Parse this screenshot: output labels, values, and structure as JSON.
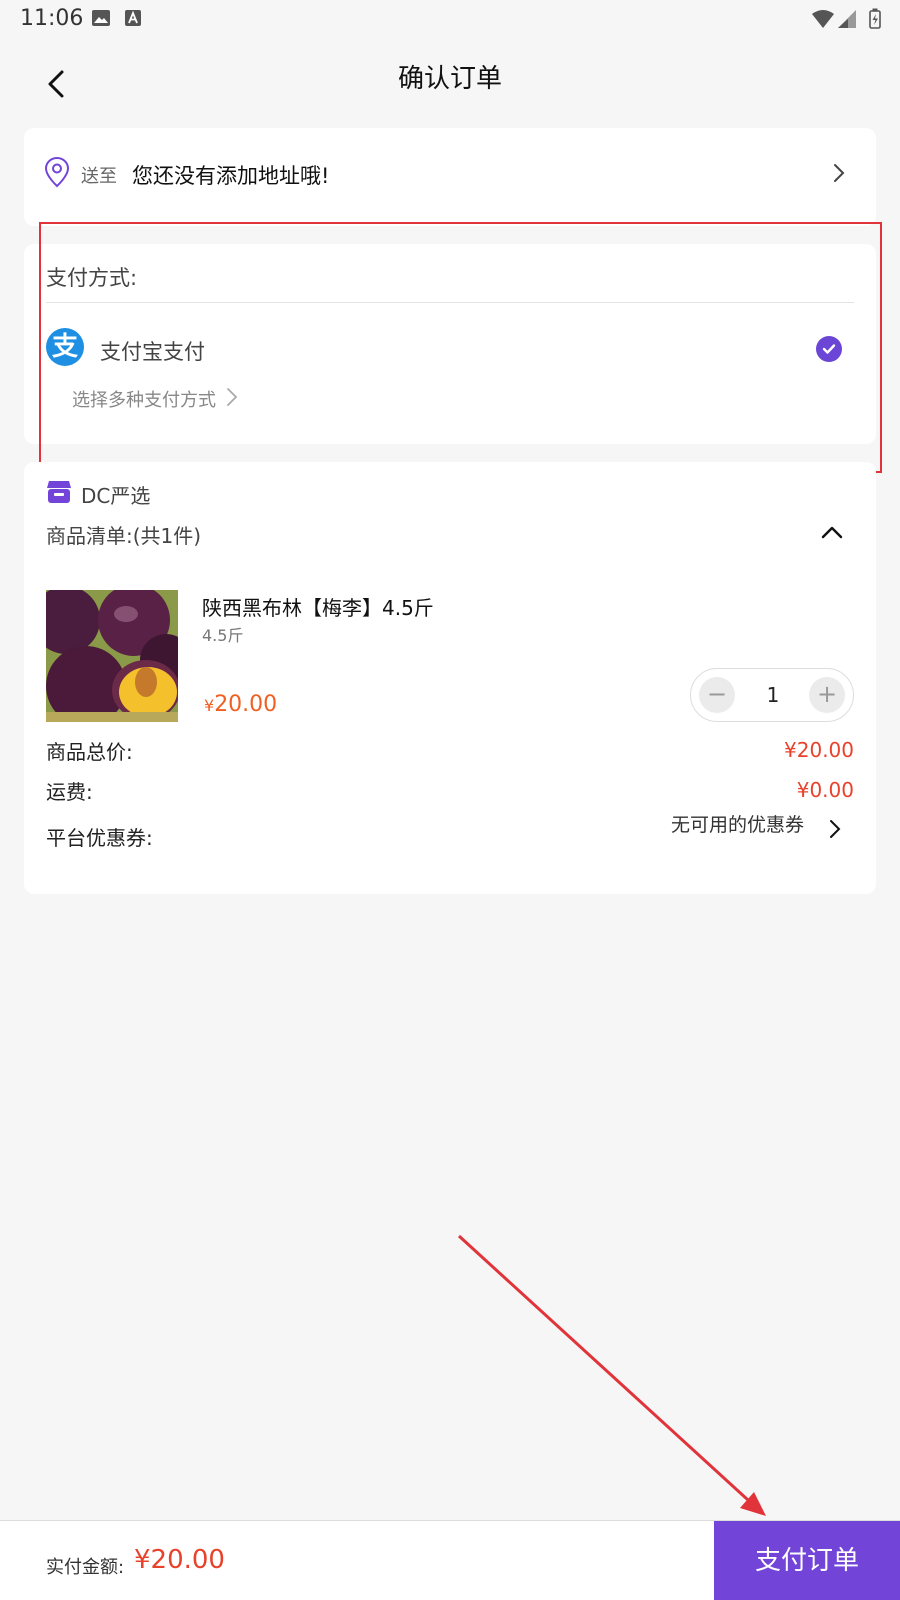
{
  "status_bar": {
    "time": "11:06"
  },
  "nav": {
    "title": "确认订单",
    "back_icon": "chevron-left-icon"
  },
  "address": {
    "prefix": "送至",
    "text": "您还没有添加地址哦!",
    "icon": "location-pin-icon"
  },
  "payment": {
    "title": "支付方式:",
    "method_label": "支付宝支付",
    "method_logo_char": "支",
    "selected": true,
    "more_label": "选择多种支付方式"
  },
  "store": {
    "name": "DC严选"
  },
  "goods": {
    "count_label": "商品清单:(共1件)",
    "items": [
      {
        "name": "陕西黑布林【梅李】4.5斤",
        "spec": "4.5斤",
        "currency": "¥",
        "price": "20.00",
        "quantity": "1"
      }
    ]
  },
  "summary": {
    "subtotal_label": "商品总价:",
    "subtotal_value": "¥20.00",
    "shipping_label": "运费:",
    "shipping_value": "¥0.00",
    "coupon_label": "平台优惠券:",
    "coupon_value": "无可用的优惠券"
  },
  "bottom": {
    "total_label": "实付金额:",
    "total_value": "¥20.00",
    "pay_button": "支付订单"
  },
  "colors": {
    "accent": "#7244d8",
    "price": "#e8422b",
    "alipay": "#1e8fe3",
    "annotation": "#e0343a"
  }
}
